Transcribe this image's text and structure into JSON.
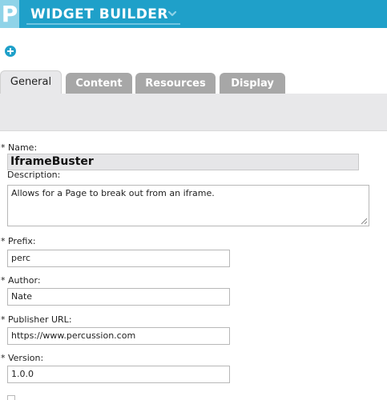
{
  "header": {
    "logo_letter": "P",
    "title": "WIDGET BUILDER",
    "caret_icon": "chevron-down-icon"
  },
  "toolbar": {
    "add_icon": "plus-circle-icon"
  },
  "tabs": [
    {
      "label": "General",
      "active": true
    },
    {
      "label": "Content",
      "active": false
    },
    {
      "label": "Resources",
      "active": false
    },
    {
      "label": "Display",
      "active": false
    }
  ],
  "form": {
    "name_label": "* Name:",
    "name_value": "IframeBuster",
    "description_label": "Description:",
    "description_value": "Allows for a Page to break out from an iframe.",
    "prefix_label": "* Prefix:",
    "prefix_value": "perc",
    "author_label": "* Author:",
    "author_value": "Nate",
    "publisher_url_label": "* Publisher URL:",
    "publisher_url_value": "https://www.percussion.com",
    "version_label": "* Version:",
    "version_value": "1.0.0"
  },
  "colors": {
    "brand": "#1fa0c9",
    "tab_inactive": "#a7a7a7",
    "tab_active": "#e8e8ea"
  }
}
